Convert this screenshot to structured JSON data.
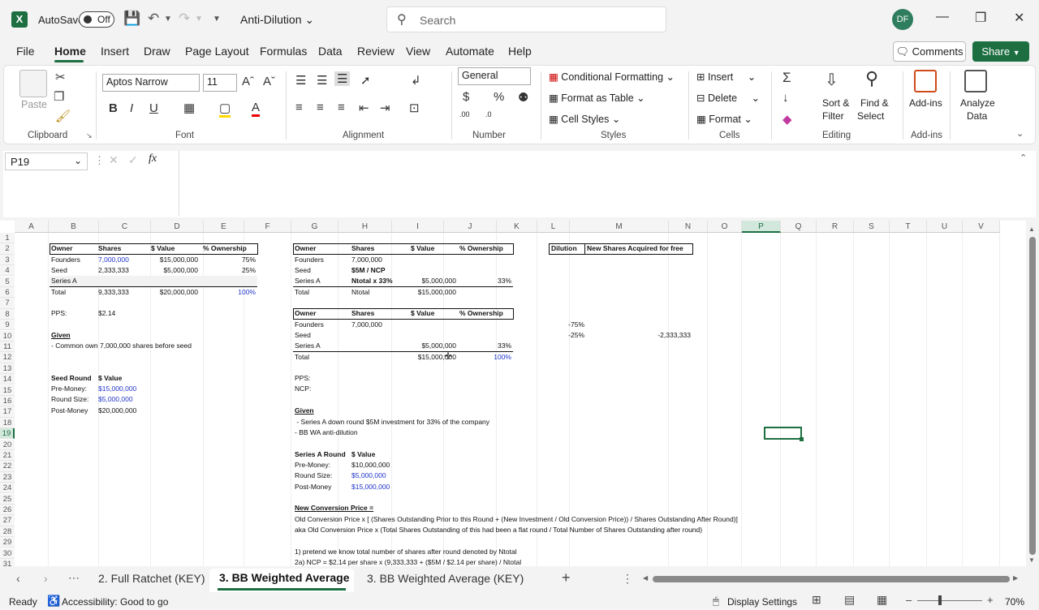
{
  "titlebar": {
    "autosave_label": "AutoSave",
    "autosave_state": "Off",
    "doc_title": "Anti-Dilution",
    "search_placeholder": "Search",
    "user_initials": "DF"
  },
  "menu": {
    "items": [
      "File",
      "Home",
      "Insert",
      "Draw",
      "Page Layout",
      "Formulas",
      "Data",
      "Review",
      "View",
      "Automate",
      "Help"
    ],
    "active": "Home",
    "comments": "Comments",
    "share": "Share"
  },
  "ribbon": {
    "clipboard": {
      "paste": "Paste",
      "group": "Clipboard"
    },
    "font": {
      "name": "Aptos Narrow",
      "size": "11",
      "group": "Font",
      "bold": "B",
      "italic": "I",
      "underline": "U"
    },
    "alignment": {
      "group": "Alignment"
    },
    "number": {
      "format": "General",
      "group": "Number"
    },
    "styles": {
      "conditional": "Conditional Formatting",
      "table": "Format as Table",
      "cell": "Cell Styles",
      "group": "Styles"
    },
    "cells": {
      "insert": "Insert",
      "delete": "Delete",
      "format": "Format",
      "group": "Cells"
    },
    "editing": {
      "sort_line1": "Sort &",
      "sort_line2": "Filter",
      "find_line1": "Find &",
      "find_line2": "Select",
      "group": "Editing"
    },
    "addins": {
      "label": "Add-ins",
      "group": "Add-ins"
    },
    "analyze": {
      "line1": "Analyze",
      "line2": "Data"
    }
  },
  "formula_bar": {
    "name_box": "P19",
    "fx": "fx",
    "formula": ""
  },
  "columns": [
    "A",
    "B",
    "C",
    "D",
    "E",
    "F",
    "G",
    "H",
    "I",
    "J",
    "K",
    "L",
    "M",
    "N",
    "O",
    "P",
    "Q",
    "R",
    "S",
    "T",
    "U",
    "V"
  ],
  "rows": [
    "1",
    "2",
    "3",
    "4",
    "5",
    "6",
    "7",
    "8",
    "9",
    "10",
    "11",
    "12",
    "13",
    "14",
    "15",
    "16",
    "17",
    "18",
    "19",
    "20",
    "21",
    "22",
    "23",
    "24",
    "25",
    "26",
    "27",
    "28",
    "29",
    "30",
    "31"
  ],
  "sheet": {
    "t1": {
      "headers": [
        "Owner",
        "Shares",
        "$ Value",
        "% Ownership"
      ],
      "rows": [
        [
          "Founders",
          "7,000,000",
          "$15,000,000",
          "75%"
        ],
        [
          "Seed",
          "2,333,333",
          "$5,000,000",
          "25%"
        ],
        [
          "Series A",
          "",
          "",
          ""
        ],
        [
          "Total",
          "9,333,333",
          "$20,000,000",
          "100%"
        ]
      ]
    },
    "pps_label": "PPS:",
    "pps_value": "$2.14",
    "given_title": "Given",
    "given_line": "- Common own 7,000,000 shares before seed",
    "seed_round": {
      "h1": "Seed Round",
      "h2": "$ Value",
      "rows": [
        [
          "Pre-Money:",
          "$15,000,000"
        ],
        [
          "Round Size:",
          "$5,000,000"
        ],
        [
          "Post-Money",
          "$20,000,000"
        ]
      ]
    },
    "t2": {
      "headers": [
        "Owner",
        "Shares",
        "$ Value",
        "% Ownership"
      ],
      "rows": [
        [
          "Founders",
          "7,000,000",
          "",
          ""
        ],
        [
          "Seed",
          "$5M / NCP",
          "",
          ""
        ],
        [
          "Series A",
          "Ntotal x 33%",
          "$5,000,000",
          "33%"
        ],
        [
          "Total",
          "Ntotal",
          "$15,000,000",
          ""
        ]
      ]
    },
    "t3": {
      "headers": [
        "Owner",
        "Shares",
        "$ Value",
        "% Ownership"
      ],
      "rows": [
        [
          "Founders",
          "7,000,000",
          "",
          ""
        ],
        [
          "Seed",
          "",
          "",
          ""
        ],
        [
          "Series A",
          "",
          "$5,000,000",
          "33%"
        ],
        [
          "Total",
          "",
          "$15,000,000",
          "100%"
        ]
      ]
    },
    "pps2_label": "PPS:",
    "ncp_label": "NCP:",
    "given2_title": "Given",
    "given2_lines": [
      " - Series A down round $5M investment for 33% of the company",
      "- BB WA anti-dilution"
    ],
    "series_a_round": {
      "h1": "Series A Round",
      "h2": "$ Value",
      "rows": [
        [
          "Pre-Money:",
          "$10,000,000"
        ],
        [
          "Round Size:",
          "$5,000,000"
        ],
        [
          "Post-Money",
          "$15,000,000"
        ]
      ]
    },
    "ncp_title": "New Conversion Price =",
    "ncp_lines": [
      "Old Conversion Price x [ (Shares Outstanding Prior to this Round + (New Investment / Old Conversion Price)) / Shares Outstanding After Round)]",
      "aka Old Conversion Price x (Total Shares Outstanding of this had been a flat round / Total Number of Shares Outstanding after round)",
      "",
      "1) pretend we know total number of shares after round denoted by Ntotal",
      "2a) NCP = $2.14 per share x (9,333,333 + ($5M / $2.14 per share) / Ntotal"
    ],
    "dilution": {
      "h1": "Dilution",
      "h2": "New Shares Acquired for free",
      "r9": "-75%",
      "r10": "-25%",
      "r10b": "-2,333,333"
    }
  },
  "tabs": {
    "items": [
      "2. Full Ratchet (KEY)",
      "3. BB Weighted Average",
      "3. BB Weighted Average (KEY)"
    ],
    "active": "3. BB Weighted Average",
    "add": "+"
  },
  "status": {
    "ready": "Ready",
    "accessibility": "Accessibility: Good to go",
    "display_settings": "Display Settings",
    "zoom": "70%"
  }
}
